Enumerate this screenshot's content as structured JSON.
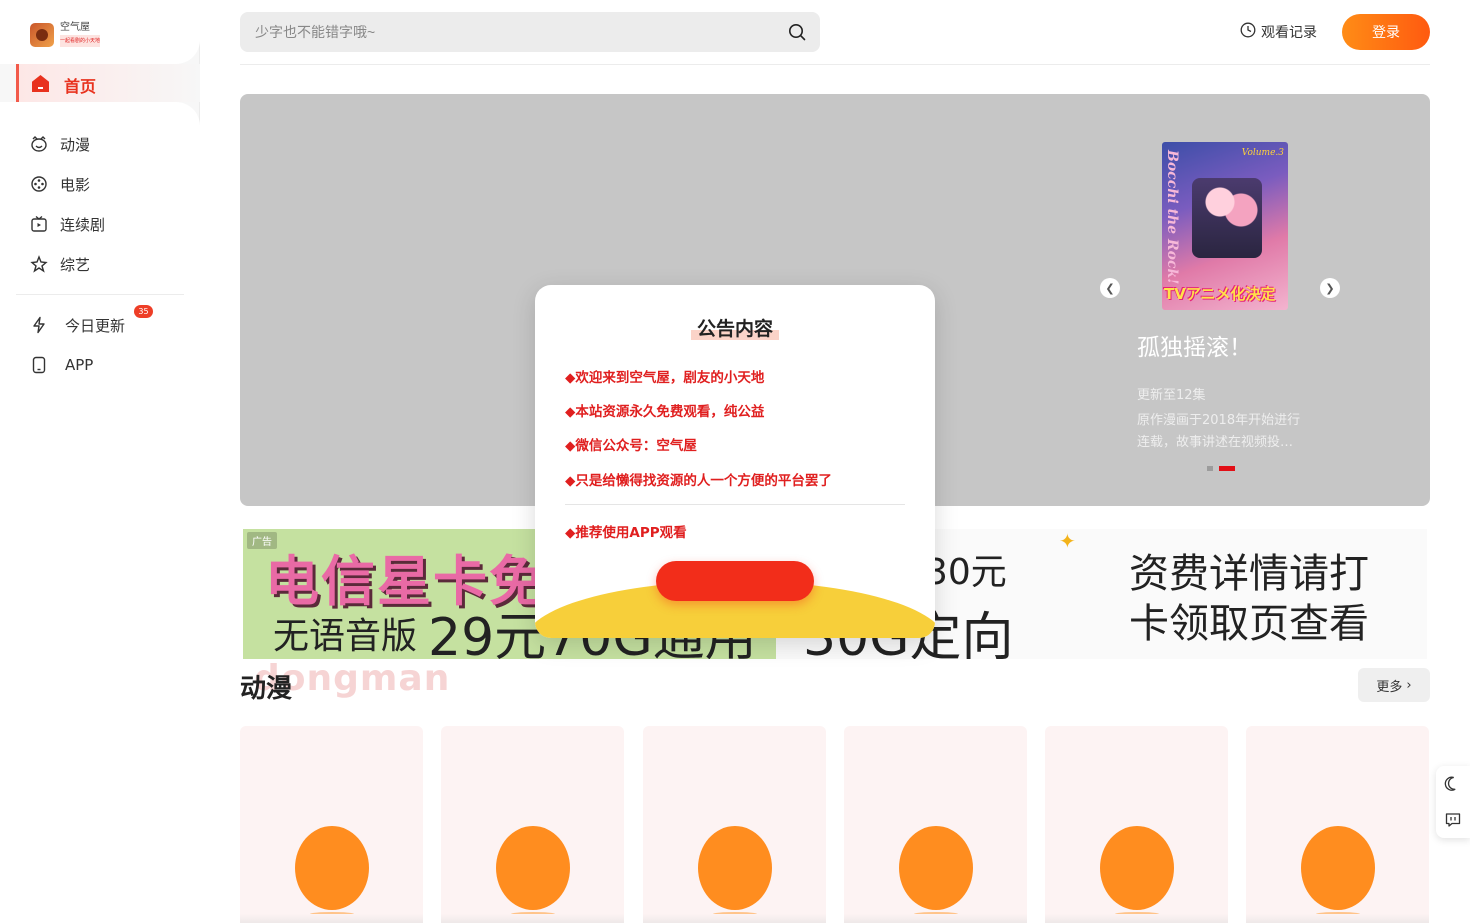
{
  "brand": {
    "name": "空气屋",
    "tagline": "一起看剧的小天地"
  },
  "search": {
    "placeholder": "少字也不能错字哦~"
  },
  "header": {
    "history_label": "观看记录",
    "login_label": "登录"
  },
  "sidebar": {
    "home_label": "首页",
    "items": [
      {
        "label": "动漫",
        "icon": "bear-face-icon"
      },
      {
        "label": "电影",
        "icon": "film-reel-icon"
      },
      {
        "label": "连续剧",
        "icon": "tv-icon"
      },
      {
        "label": "综艺",
        "icon": "star-icon"
      }
    ],
    "extra_items": [
      {
        "label": "今日更新",
        "icon": "lightning-icon",
        "badge": "35"
      },
      {
        "label": "APP",
        "icon": "phone-icon"
      }
    ]
  },
  "banner": {
    "poster_title": "Bocchi the Rock!",
    "poster_volume": "Volume.3",
    "poster_caption": "TVアニメ化決定",
    "title": "孤独摇滚！",
    "subtitle": "更新至12集",
    "description": "原作漫画于2018年开始进行连载，故事讲述在视频投…",
    "prev_icon": "chevron-left-icon",
    "next_icon": "chevron-right-icon",
    "active_slide": 2,
    "slide_count": 2
  },
  "ad": {
    "tag": "广告",
    "headline_left": "电信星卡免",
    "line_left": "无语音版",
    "price": "29元70G通用",
    "frag_top": "30元",
    "frag_bottom": "30G定向",
    "right_top": "资费详情请打",
    "right_bottom": "卡领取页查看"
  },
  "section": {
    "title": "动漫",
    "ghost": "dongman",
    "more_label": "更多"
  },
  "cards_count": 6,
  "modal": {
    "title": "公告内容",
    "notices": [
      "◆欢迎来到空气屋，剧友的小天地",
      "◆本站资源永久免费观看，纯公益",
      "◆微信公众号：空气屋",
      "◆只是给懒得找资源的人一个方便的平台罢了"
    ],
    "footer_notice": "◆推荐使用APP观看"
  },
  "colors": {
    "accent": "#e8321e",
    "login_gradient_start": "#ff8c16",
    "login_gradient_end": "#ff5a10",
    "notice_red": "#e01f1f",
    "modal_arc": "#f7cf3a"
  }
}
